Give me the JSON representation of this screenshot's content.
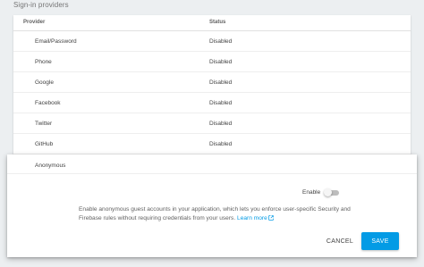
{
  "section": {
    "title": "Sign-in providers"
  },
  "table": {
    "columns": {
      "provider": "Provider",
      "status": "Status"
    },
    "rows": [
      {
        "provider": "Email/Password",
        "status": "Disabled"
      },
      {
        "provider": "Phone",
        "status": "Disabled"
      },
      {
        "provider": "Google",
        "status": "Disabled"
      },
      {
        "provider": "Facebook",
        "status": "Disabled"
      },
      {
        "provider": "Twitter",
        "status": "Disabled"
      },
      {
        "provider": "GitHub",
        "status": "Disabled"
      }
    ]
  },
  "expanded": {
    "provider": "Anonymous",
    "enable_label": "Enable",
    "enabled": false,
    "description": "Enable anonymous guest accounts in your application, which lets you enforce user-specific Security and Firebase rules without requiring credentials from your users.",
    "learn_more": "Learn more",
    "learn_more_icon": "external-link-icon",
    "cancel_label": "CANCEL",
    "save_label": "SAVE"
  },
  "colors": {
    "accent": "#039be5",
    "background": "#eceff1"
  }
}
